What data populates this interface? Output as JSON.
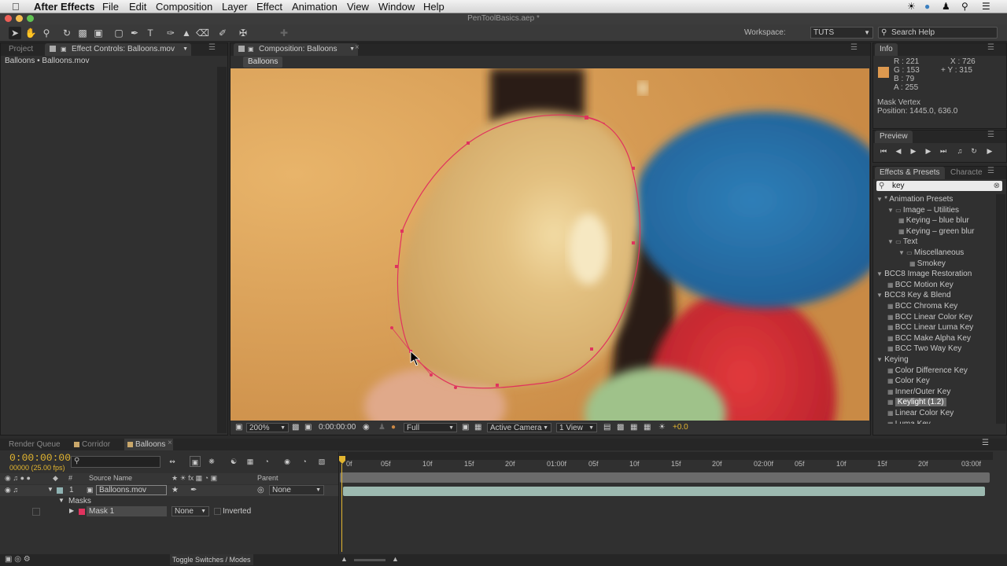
{
  "menubar": {
    "app": "After Effects",
    "items": [
      "File",
      "Edit",
      "Composition",
      "Layer",
      "Effect",
      "Animation",
      "View",
      "Window",
      "Help"
    ]
  },
  "window": {
    "title": "PenToolBasics.aep *"
  },
  "workspace": {
    "label": "Workspace:",
    "value": "TUTS"
  },
  "search_help": {
    "placeholder": "Search Help"
  },
  "left_panel": {
    "tabs": [
      "Project",
      "Effect Controls: Balloons.mov"
    ],
    "breadcrumb": "Balloons • Balloons.mov"
  },
  "comp": {
    "tab": "Composition: Balloons",
    "sub_tab": "Balloons"
  },
  "viewer_bar": {
    "zoom": "200%",
    "timecode": "0:00:00:00",
    "resolution": "Full",
    "camera": "Active Camera",
    "view": "1 View",
    "exposure": "+0.0"
  },
  "info": {
    "tab": "Info",
    "r": "R : 221",
    "g": "G : 153",
    "b": "B : 79",
    "a": "A : 255",
    "x": "X : 726",
    "y": "+ Y : 315",
    "swatch": "#dd994f",
    "mask_title": "Mask Vertex",
    "position": "Position: 1445.0, 636.0"
  },
  "preview": {
    "tab": "Preview"
  },
  "effects": {
    "tabs": [
      "Effects & Presets",
      "Characte"
    ],
    "search": "key",
    "tree": [
      {
        "label": "* Animation Presets",
        "indent": 0,
        "kind": "group"
      },
      {
        "label": "Image – Utilities",
        "indent": 1,
        "kind": "folder"
      },
      {
        "label": "Keying – blue blur",
        "indent": 2,
        "kind": "preset"
      },
      {
        "label": "Keying – green blur",
        "indent": 2,
        "kind": "preset"
      },
      {
        "label": "Text",
        "indent": 1,
        "kind": "folder"
      },
      {
        "label": "Miscellaneous",
        "indent": 2,
        "kind": "folder"
      },
      {
        "label": "Smokey",
        "indent": 3,
        "kind": "preset"
      },
      {
        "label": "BCC8 Image Restoration",
        "indent": 0,
        "kind": "group"
      },
      {
        "label": "BCC Motion Key",
        "indent": 1,
        "kind": "effect"
      },
      {
        "label": "BCC8 Key & Blend",
        "indent": 0,
        "kind": "group"
      },
      {
        "label": "BCC Chroma Key",
        "indent": 1,
        "kind": "effect"
      },
      {
        "label": "BCC Linear Color Key",
        "indent": 1,
        "kind": "effect"
      },
      {
        "label": "BCC Linear Luma Key",
        "indent": 1,
        "kind": "effect"
      },
      {
        "label": "BCC Make Alpha Key",
        "indent": 1,
        "kind": "effect"
      },
      {
        "label": "BCC Two Way Key",
        "indent": 1,
        "kind": "effect"
      },
      {
        "label": "Keying",
        "indent": 0,
        "kind": "group"
      },
      {
        "label": "Color Difference Key",
        "indent": 1,
        "kind": "effect"
      },
      {
        "label": "Color Key",
        "indent": 1,
        "kind": "effect"
      },
      {
        "label": "Inner/Outer Key",
        "indent": 1,
        "kind": "effect"
      },
      {
        "label": "Keylight (1.2)",
        "indent": 1,
        "kind": "effect",
        "selected": true
      },
      {
        "label": "Linear Color Key",
        "indent": 1,
        "kind": "effect"
      },
      {
        "label": "Luma Key",
        "indent": 1,
        "kind": "effect"
      }
    ]
  },
  "timeline": {
    "tabs": [
      "Render Queue",
      "Corridor",
      "Balloons"
    ],
    "timecode": "0:00:00:00",
    "fps": "00000 (25.00 fps)",
    "ruler": [
      "0f",
      "05f",
      "10f",
      "15f",
      "20f",
      "01:00f",
      "05f",
      "10f",
      "15f",
      "20f",
      "02:00f",
      "05f",
      "10f",
      "15f",
      "20f",
      "03:00f"
    ],
    "headers": {
      "num": "#",
      "source": "Source Name",
      "parent": "Parent"
    },
    "layer": {
      "num": "1",
      "name": "Balloons.mov",
      "parent": "None"
    },
    "masks_label": "Masks",
    "mask": {
      "name": "Mask 1",
      "mode": "None",
      "inverted": "Inverted"
    },
    "toggle": "Toggle Switches / Modes"
  }
}
